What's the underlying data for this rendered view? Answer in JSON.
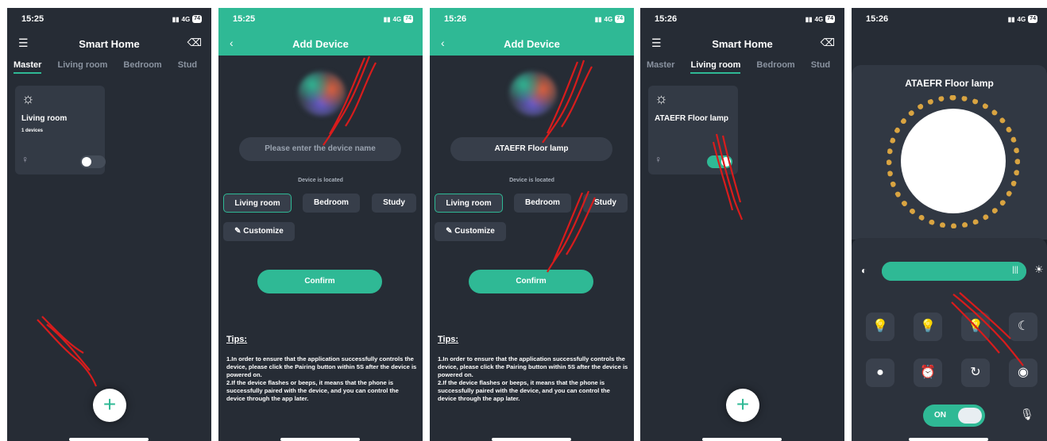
{
  "colors": {
    "accent": "#2fb995",
    "panel": "#262c35",
    "card": "#333a45",
    "annotation": "#d81c1c"
  },
  "status": {
    "times": [
      "15:25",
      "15:25",
      "15:26",
      "15:26",
      "15:26"
    ],
    "network": "4G",
    "battery": "74"
  },
  "home": {
    "title": "Smart Home",
    "tabs": [
      "Master",
      "Living room",
      "Bedroom",
      "Stud"
    ]
  },
  "screen1": {
    "card_title": "Living room",
    "card_sub": "1 devices",
    "fab": "+"
  },
  "add": {
    "title": "Add Device",
    "name_placeholder": "Please enter the device name",
    "name_value": "ATAEFR Floor lamp",
    "location_label": "Device is located",
    "rooms": [
      "Living room",
      "Bedroom",
      "Study"
    ],
    "customize": "Customize",
    "confirm": "Confirm",
    "tips_title": "Tips:",
    "tips_text": "1.In order to ensure that the application successfully controls the device, please click the Pairing button within 5S after the device is powered on.\n2.If the device flashes or beeps, it means that the phone is successfully paired with the device, and you can control the device through the app later."
  },
  "screen4": {
    "card_title": "ATAEFR Floor lamp",
    "fab": "+"
  },
  "lamp": {
    "title": "ATAEFR Floor lamp",
    "on": "ON",
    "brightness": 1.0
  },
  "icons": [
    "menu-icon",
    "eraser-icon",
    "back-icon",
    "bulb-icon",
    "moon-icon",
    "alarm-icon",
    "mic-icon",
    "sun-icon"
  ]
}
